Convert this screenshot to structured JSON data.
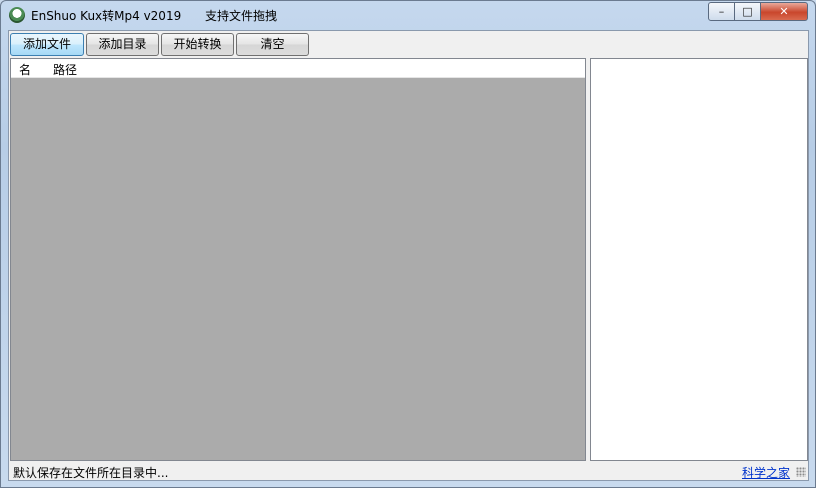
{
  "window": {
    "title": "EnShuo Kux转Mp4  v2019",
    "title_hint": "支持文件拖拽",
    "controls": {
      "minimize": "–",
      "maximize": "□",
      "close": "✕"
    }
  },
  "toolbar": {
    "add_file": "添加文件",
    "add_folder": "添加目录",
    "start_convert": "开始转换",
    "clear": "清空"
  },
  "file_list": {
    "columns": [
      "名",
      "路径"
    ],
    "rows": []
  },
  "status": {
    "text": "默认保存在文件所在目录中...",
    "link": "科学之家"
  },
  "colors": {
    "list_background": "#ababab",
    "link": "#0033cc"
  }
}
